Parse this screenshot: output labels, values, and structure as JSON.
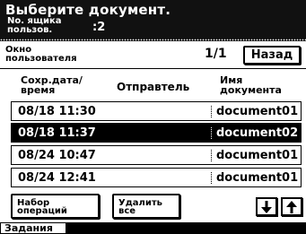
{
  "header": {
    "title": "Выберите документ.",
    "box_label_line1": "No. ящика",
    "box_label_line2": "пользов.",
    "box_value": ":2"
  },
  "subheader": {
    "box_type_line1": "Окно",
    "box_type_line2": "пользователя",
    "page_indicator": "1/1",
    "back_label": "Назад"
  },
  "columns": {
    "date_line1": "Сохр.дата/",
    "date_line2": "время",
    "sender": "Отправтель",
    "name_line1": "Имя",
    "name_line2": "документа"
  },
  "rows": [
    {
      "date": "08/18 11:30",
      "doc": "document01",
      "selected": false
    },
    {
      "date": "08/18 11:37",
      "doc": "document02",
      "selected": true
    },
    {
      "date": "08/24 10:47",
      "doc": "document01",
      "selected": false
    },
    {
      "date": "08/24 12:41",
      "doc": "document01",
      "selected": false
    }
  ],
  "buttons": {
    "menu_line1": "Набор",
    "menu_line2": "операций",
    "delete_line1": "Удалить",
    "delete_line2": "все",
    "down_icon": "arrow-down-icon",
    "up_icon": "arrow-up-icon"
  },
  "footer": {
    "jobs_tab": "Задания"
  }
}
